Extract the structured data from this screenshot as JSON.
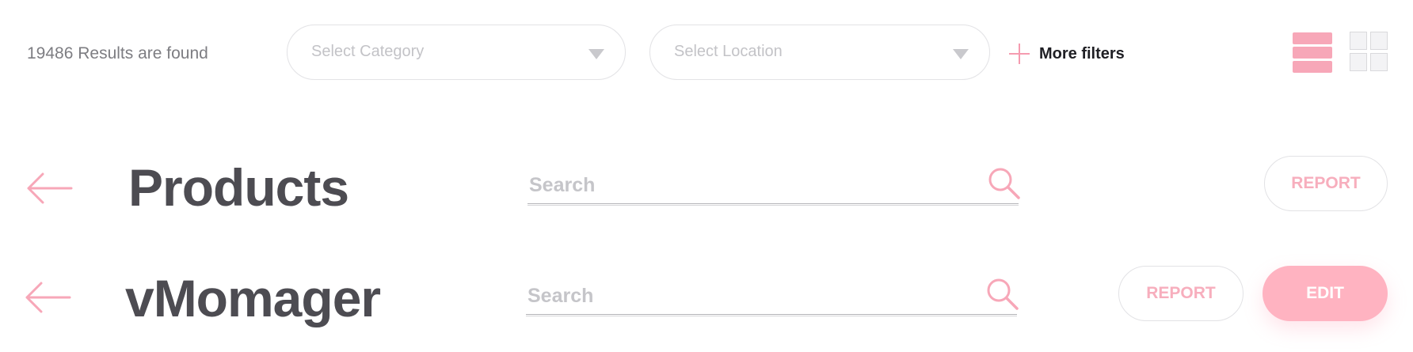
{
  "filter_bar": {
    "results_text": "19486 Results are found",
    "category_select": {
      "placeholder": "Select Category"
    },
    "location_select": {
      "placeholder": "Select Location"
    },
    "more_filters_label": "More filters",
    "view_modes": [
      "list-view-icon",
      "grid-view-icon"
    ],
    "active_view": "list"
  },
  "products_header": {
    "title": "Products",
    "search_placeholder": "Search",
    "report_label": "REPORT"
  },
  "manager_header": {
    "title": "vMomager",
    "search_placeholder": "Search",
    "report_label": "REPORT",
    "edit_label": "EDIT"
  },
  "colors": {
    "accent": "#f7a7b8",
    "title": "#4d4c52",
    "muted": "#c3c3c7"
  }
}
